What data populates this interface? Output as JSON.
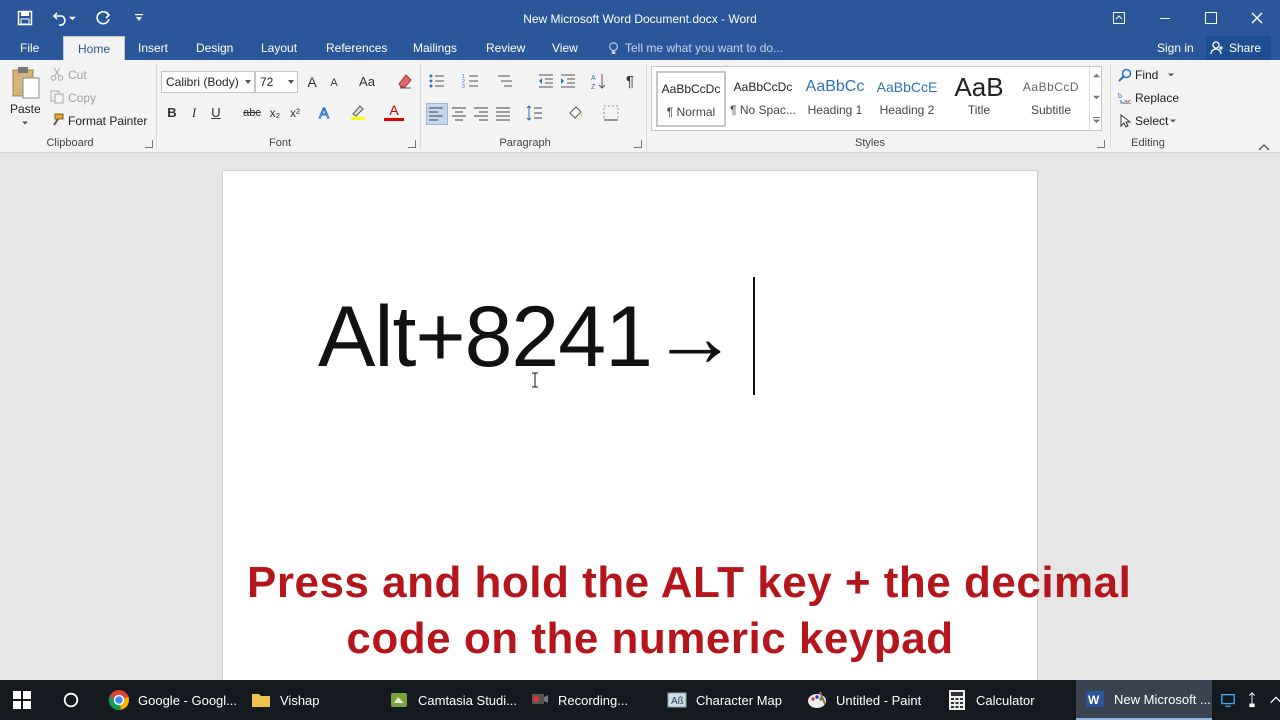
{
  "window": {
    "title": "New Microsoft Word Document.docx - Word"
  },
  "tabs": {
    "file": "File",
    "home": "Home",
    "insert": "Insert",
    "design": "Design",
    "layout": "Layout",
    "references": "References",
    "mailings": "Mailings",
    "review": "Review",
    "view": "View"
  },
  "tell_me": {
    "placeholder": "Tell me what you want to do..."
  },
  "account": {
    "sign_in": "Sign in",
    "share": "Share"
  },
  "clipboard": {
    "paste": "Paste",
    "cut": "Cut",
    "copy": "Copy",
    "format_painter": "Format Painter",
    "label": "Clipboard"
  },
  "font": {
    "name": "Calibri (Body)",
    "size": "72",
    "bold": "B",
    "italic": "I",
    "underline": "U",
    "strike": "abc",
    "subscript": "x₂",
    "superscript": "x²",
    "grow": "A",
    "shrink": "A",
    "case": "Aa",
    "font_color": "A",
    "label": "Font"
  },
  "paragraph": {
    "label": "Paragraph"
  },
  "styles": {
    "label": "Styles",
    "items": [
      {
        "preview": "AaBbCcDc",
        "name": "¶ Normal"
      },
      {
        "preview": "AaBbCcDc",
        "name": "¶ No Spac..."
      },
      {
        "preview": "AaBbCc",
        "name": "Heading 1"
      },
      {
        "preview": "AaBbCcE",
        "name": "Heading 2"
      },
      {
        "preview": "AaB",
        "name": "Title"
      },
      {
        "preview": "AaBbCcD",
        "name": "Subtitle"
      }
    ]
  },
  "editing": {
    "find": "Find",
    "replace": "Replace",
    "select": "Select",
    "label": "Editing"
  },
  "document": {
    "text": "Alt+8241→"
  },
  "caption": {
    "line1": "Press and hold the ALT key + the decimal",
    "line2": "code on the numeric keypad"
  },
  "taskbar": {
    "items": [
      {
        "label": "Google - Googl..."
      },
      {
        "label": "Vishap"
      },
      {
        "label": "Camtasia Studi..."
      },
      {
        "label": "Recording..."
      },
      {
        "label": "Character Map"
      },
      {
        "label": "Untitled - Paint"
      },
      {
        "label": "Calculator"
      },
      {
        "label": "New Microsoft ..."
      }
    ]
  },
  "colors": {
    "word_blue": "#2b579a",
    "caption_red": "#b5161b",
    "taskbar": "#151a20"
  }
}
